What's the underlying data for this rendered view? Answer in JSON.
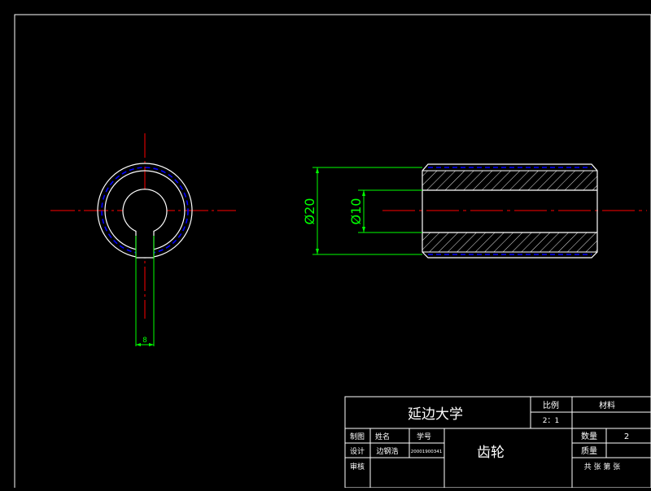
{
  "colors": {
    "background": "#000000",
    "outline": "#ffffff",
    "centerline": "#ff0000",
    "dimension": "#00ff00",
    "hidden_edge": "#0000ff"
  },
  "front_view": {
    "key_width_dim": "8"
  },
  "side_view": {
    "outer_dia_dim": "Ø20",
    "inner_dia_dim": "Ø10"
  },
  "title_block": {
    "school": "延边大学",
    "scale_label": "比例",
    "scale_value": "2：1",
    "material_label": "材料",
    "material_value": "",
    "drawn_label": "制图",
    "name_label": "姓名",
    "student_id_label": "学号",
    "design_label": "设计",
    "designer_name": "边钢浩",
    "student_id": "20001900341",
    "review_label": "审核",
    "part_name": "齿轮",
    "quantity_label": "数量",
    "quantity_value": "2",
    "mass_label": "质量",
    "sheet_info": "共 张 第 张"
  }
}
